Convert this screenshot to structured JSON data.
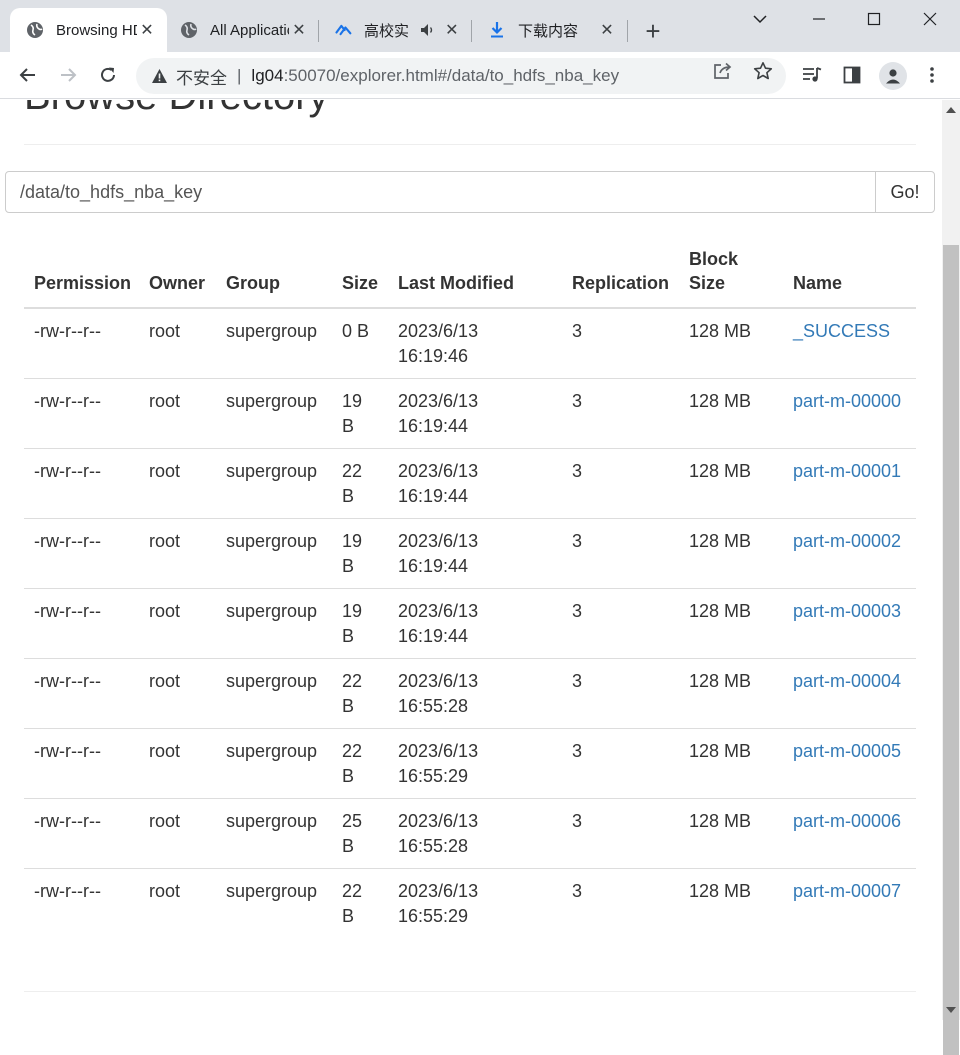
{
  "browser": {
    "tabs": [
      {
        "title": "Browsing HDFS",
        "icon": "globe-icon",
        "active": true
      },
      {
        "title": "All Applications",
        "icon": "globe-icon",
        "active": false
      },
      {
        "title": "高校实验室",
        "icon": "cloud-icon",
        "audio": true,
        "active": false
      },
      {
        "title": "下载内容",
        "icon": "download-icon",
        "active": false
      }
    ],
    "address": {
      "insecure_label": "不安全",
      "host": "lg04",
      "path": ":50070/explorer.html#/data/to_hdfs_nba_key"
    }
  },
  "page": {
    "title": "Browse Directory",
    "path_value": "/data/to_hdfs_nba_key",
    "go_label": "Go!",
    "table": {
      "headers": [
        "Permission",
        "Owner",
        "Group",
        "Size",
        "Last Modified",
        "Replication",
        "Block Size",
        "Name"
      ],
      "rows": [
        {
          "permission": "-rw-r--r--",
          "owner": "root",
          "group": "supergroup",
          "size": "0 B",
          "modified": "2023/6/13 16:19:46",
          "replication": "3",
          "block_size": "128 MB",
          "name": "_SUCCESS"
        },
        {
          "permission": "-rw-r--r--",
          "owner": "root",
          "group": "supergroup",
          "size": "19 B",
          "modified": "2023/6/13 16:19:44",
          "replication": "3",
          "block_size": "128 MB",
          "name": "part-m-00000"
        },
        {
          "permission": "-rw-r--r--",
          "owner": "root",
          "group": "supergroup",
          "size": "22 B",
          "modified": "2023/6/13 16:19:44",
          "replication": "3",
          "block_size": "128 MB",
          "name": "part-m-00001"
        },
        {
          "permission": "-rw-r--r--",
          "owner": "root",
          "group": "supergroup",
          "size": "19 B",
          "modified": "2023/6/13 16:19:44",
          "replication": "3",
          "block_size": "128 MB",
          "name": "part-m-00002"
        },
        {
          "permission": "-rw-r--r--",
          "owner": "root",
          "group": "supergroup",
          "size": "19 B",
          "modified": "2023/6/13 16:19:44",
          "replication": "3",
          "block_size": "128 MB",
          "name": "part-m-00003"
        },
        {
          "permission": "-rw-r--r--",
          "owner": "root",
          "group": "supergroup",
          "size": "22 B",
          "modified": "2023/6/13 16:55:28",
          "replication": "3",
          "block_size": "128 MB",
          "name": "part-m-00004"
        },
        {
          "permission": "-rw-r--r--",
          "owner": "root",
          "group": "supergroup",
          "size": "22 B",
          "modified": "2023/6/13 16:55:29",
          "replication": "3",
          "block_size": "128 MB",
          "name": "part-m-00005"
        },
        {
          "permission": "-rw-r--r--",
          "owner": "root",
          "group": "supergroup",
          "size": "25 B",
          "modified": "2023/6/13 16:55:28",
          "replication": "3",
          "block_size": "128 MB",
          "name": "part-m-00006"
        },
        {
          "permission": "-rw-r--r--",
          "owner": "root",
          "group": "supergroup",
          "size": "22 B",
          "modified": "2023/6/13 16:55:29",
          "replication": "3",
          "block_size": "128 MB",
          "name": "part-m-00007"
        }
      ]
    }
  },
  "colors": {
    "link": "#337ab7",
    "tabstrip": "#dee1e6",
    "text": "#333333"
  }
}
